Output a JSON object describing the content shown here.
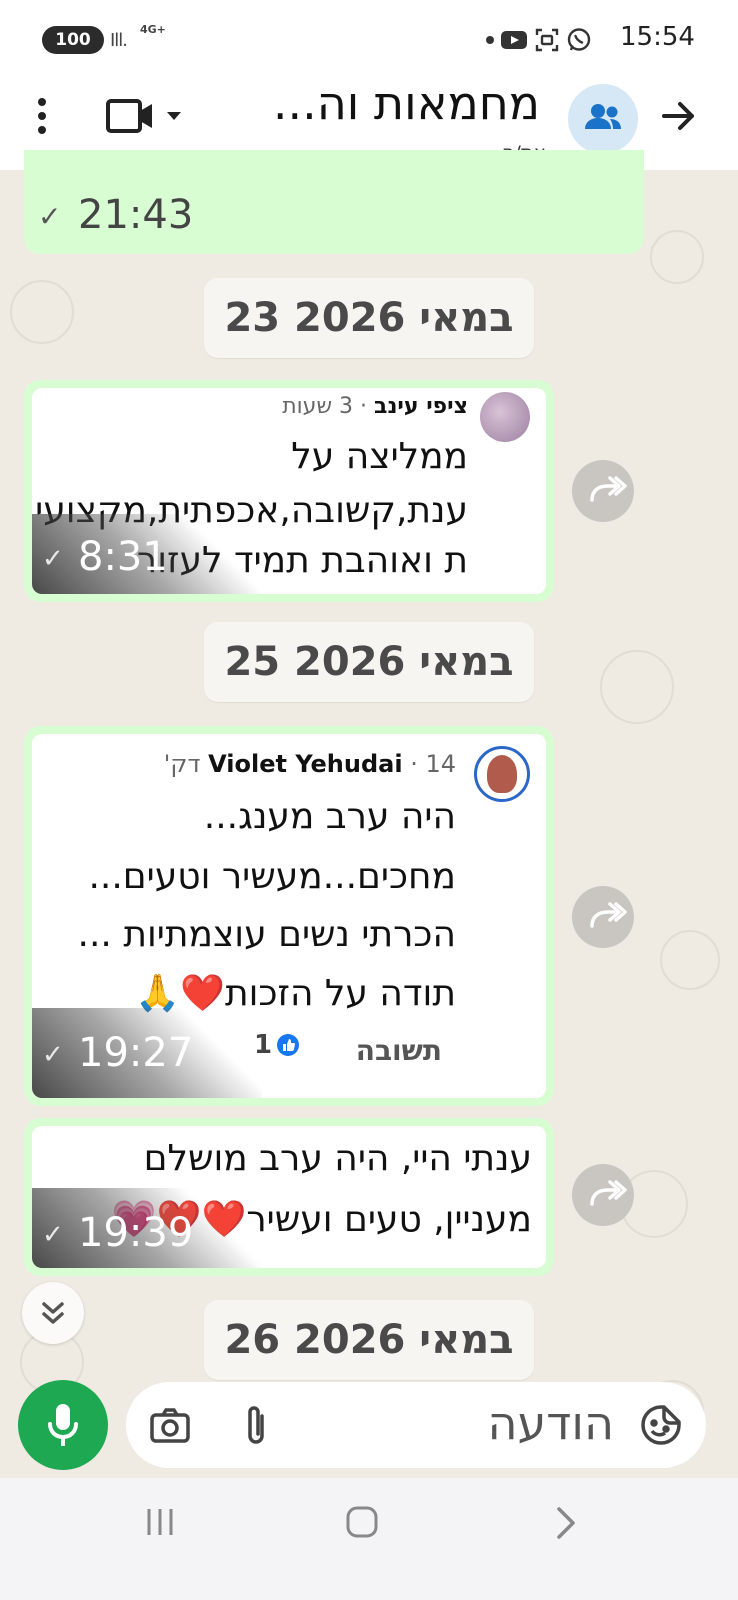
{
  "status_bar": {
    "battery": "100",
    "network": "4G+",
    "time": "15:54",
    "icons": [
      "dot-icon",
      "youtube-icon",
      "screenshot-icon",
      "whatsapp-icon"
    ]
  },
  "header": {
    "title": "מחמאות וה...",
    "subtitle": "את/ה",
    "icons": [
      "back-arrow-icon",
      "group-avatar-icon",
      "video-call-icon",
      "chevron-down-icon",
      "more-vert-icon"
    ]
  },
  "chat": {
    "top_partial": {
      "time": "21:43",
      "status": "✓"
    },
    "date_chips": [
      "23 במאי 2026",
      "25 במאי 2026",
      "26 במאי 2026"
    ],
    "messages": [
      {
        "author": "ציפי עינב",
        "ago": "· 3 שעות",
        "lines": [
          "ממליצה על",
          "ענת,קשובה,אכפתית,מקצועי",
          "ת ואוהבת תמיד לעזור"
        ],
        "time": "8:31",
        "status": "✓"
      },
      {
        "author": "Violet Yehudai",
        "ago": "· 14 דק'",
        "lines": [
          "היה ערב מענג...",
          "מחכים...מעשיר וטעים...",
          "הכרתי נשים עוצמתיות ...",
          "תודה על הזכות❤️🙏"
        ],
        "reply_label": "תשובה",
        "likes": "1",
        "time": "19:27",
        "status": "✓"
      },
      {
        "lines": [
          "ענתי היי, היה ערב מושלם",
          "מעניין, טעים ועשיר❤️❤️💗"
        ],
        "time": "19:39",
        "status": "✓"
      }
    ]
  },
  "composer": {
    "placeholder": "הודעה",
    "icons": [
      "sticker-icon",
      "attach-icon",
      "camera-icon",
      "mic-icon"
    ]
  },
  "nav": {
    "icons": [
      "recents-icon",
      "home-icon",
      "back-icon"
    ]
  },
  "colors": {
    "outgoing_bubble": "#d9fdd3",
    "mic_button": "#1da851",
    "chat_background": "#efeae2",
    "group_avatar_bg": "#d6e7f5",
    "group_avatar_fg": "#1a73c8"
  }
}
